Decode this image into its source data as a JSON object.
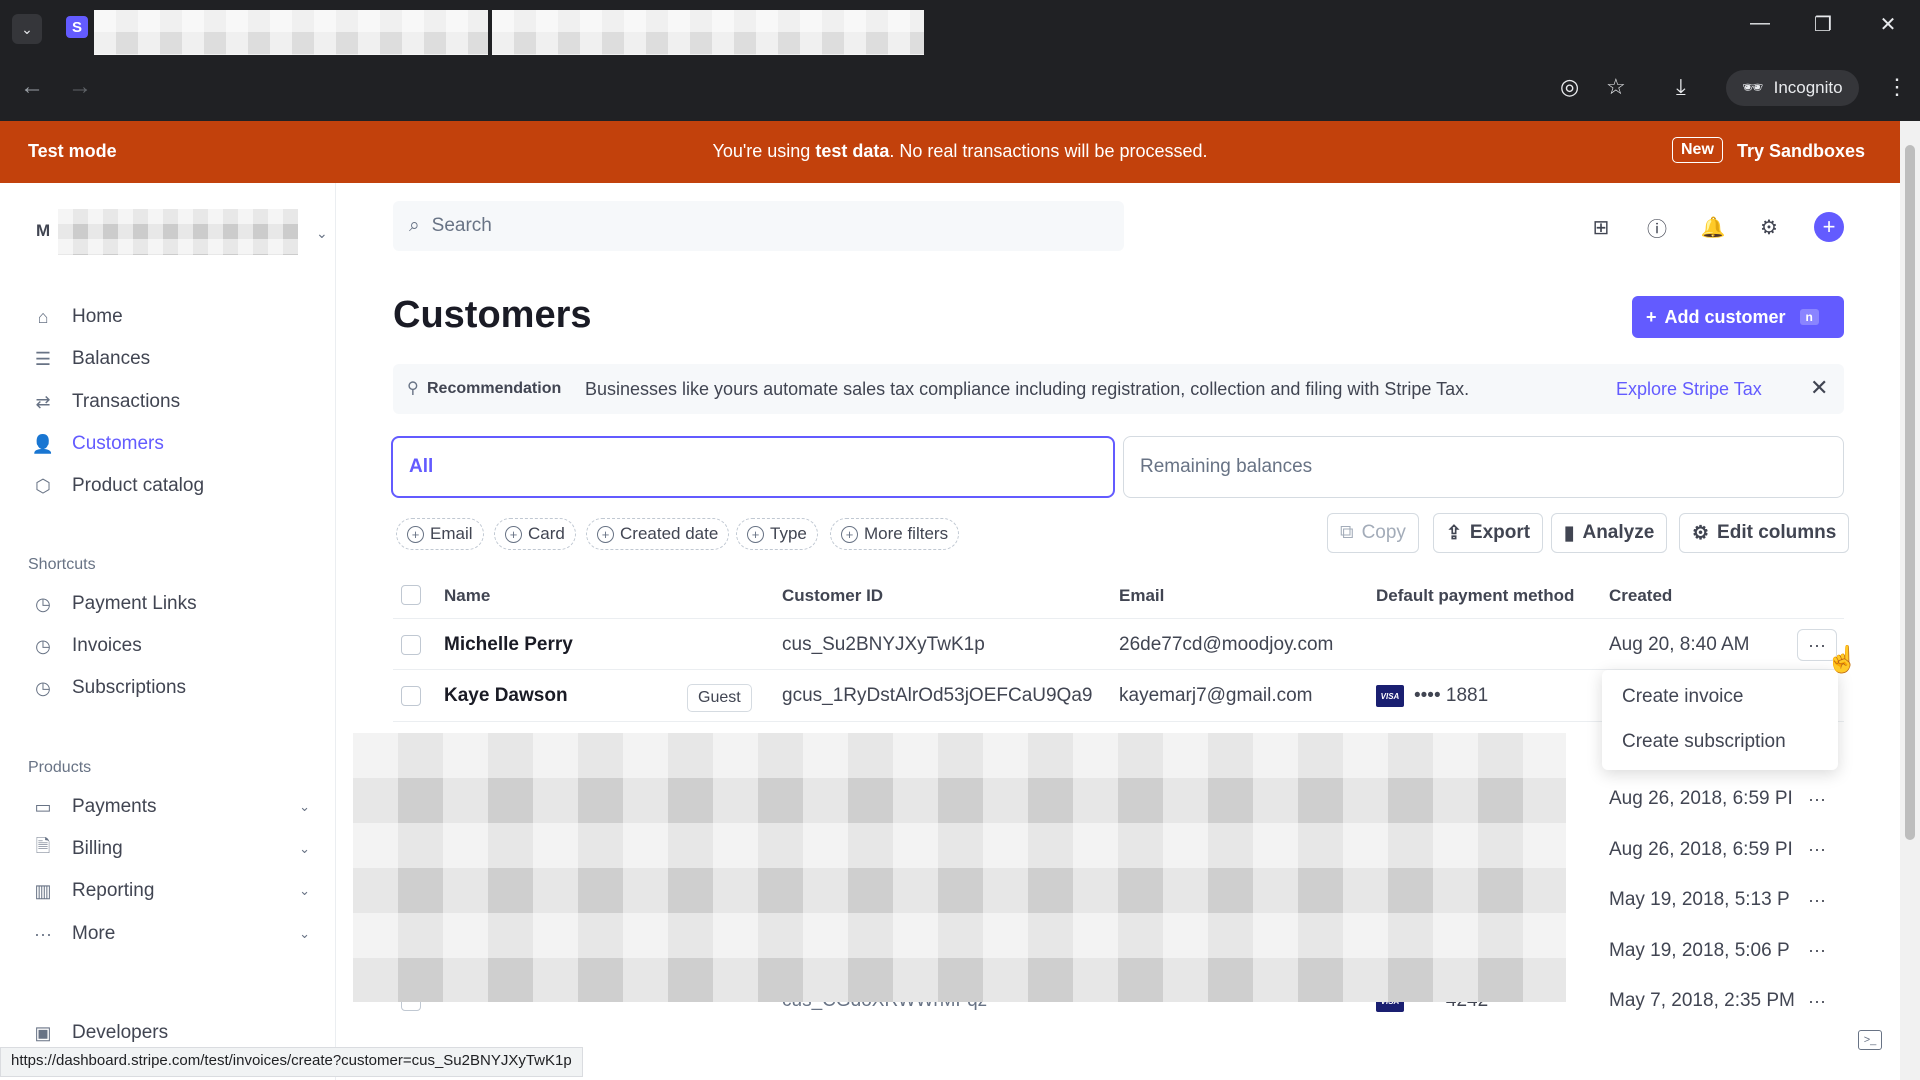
{
  "browser": {
    "incognito_label": "Incognito",
    "status_url": "https://dashboard.stripe.com/test/invoices/create?customer=cus_Su2BNYJXyTwK1p"
  },
  "banner": {
    "label": "Test mode",
    "message_prefix": "You're using ",
    "message_bold": "test data",
    "message_suffix": ". No real transactions will be processed.",
    "new_badge": "New",
    "sandbox_link": "Try Sandboxes",
    "color": "#c2410c"
  },
  "account": {
    "initial": "M"
  },
  "sidebar": {
    "items": [
      {
        "label": "Home",
        "icon": "home-icon"
      },
      {
        "label": "Balances",
        "icon": "balances-icon"
      },
      {
        "label": "Transactions",
        "icon": "transactions-icon"
      },
      {
        "label": "Customers",
        "icon": "customers-icon",
        "active": true
      },
      {
        "label": "Product catalog",
        "icon": "product-catalog-icon"
      }
    ],
    "shortcuts_label": "Shortcuts",
    "shortcuts": [
      {
        "label": "Payment Links",
        "icon": "clock-icon"
      },
      {
        "label": "Invoices",
        "icon": "clock-icon"
      },
      {
        "label": "Subscriptions",
        "icon": "clock-icon"
      }
    ],
    "products_label": "Products",
    "products": [
      {
        "label": "Payments",
        "icon": "payments-icon"
      },
      {
        "label": "Billing",
        "icon": "billing-icon"
      },
      {
        "label": "Reporting",
        "icon": "reporting-icon"
      },
      {
        "label": "More",
        "icon": "more-icon"
      }
    ],
    "developers": "Developers"
  },
  "header": {
    "search_placeholder": "Search",
    "accent": "#635bff"
  },
  "page": {
    "title": "Customers",
    "add_button": "Add customer",
    "add_shortcut": "n"
  },
  "recommendation": {
    "tag": "Recommendation",
    "text": "Businesses like yours automate sales tax compliance including registration, collection and filing with Stripe Tax.",
    "link": "Explore Stripe Tax"
  },
  "tabs": [
    {
      "label": "All",
      "selected": true
    },
    {
      "label": "Remaining balances",
      "selected": false
    }
  ],
  "filters": [
    "Email",
    "Card",
    "Created date",
    "Type",
    "More filters"
  ],
  "toolbar": {
    "copy": "Copy",
    "export": "Export",
    "analyze": "Analyze",
    "edit_columns": "Edit columns"
  },
  "table": {
    "columns": [
      "Name",
      "Customer ID",
      "Email",
      "Default payment method",
      "Created"
    ],
    "rows": [
      {
        "name": "Michelle Perry",
        "id": "cus_Su2BNYJXyTwK1p",
        "email": "26de77cd@moodjoy.com",
        "payment": "",
        "created": "Aug 20, 8:40 AM"
      },
      {
        "name": "Kaye Dawson",
        "badge": "Guest",
        "id": "gcus_1RyDstAlrOd53jOEFCaU9Qa9",
        "email": "kayemarj7@gmail.com",
        "payment": "•••• 1881",
        "created": ""
      }
    ],
    "partial_created": [
      "Aug 26, 2018, 6:59 PI",
      "Aug 26, 2018, 6:59 PI",
      "May 19, 2018, 5:13 P",
      "May 19, 2018, 5:06 P",
      "May 7, 2018, 2:35 PM"
    ],
    "last_row": {
      "id": "cus_CGdoXRWWrMFqz",
      "name": "—",
      "email": "—",
      "payment": "•••• 4242"
    }
  },
  "dropdown": {
    "options": [
      "Create invoice",
      "Create subscription"
    ]
  }
}
